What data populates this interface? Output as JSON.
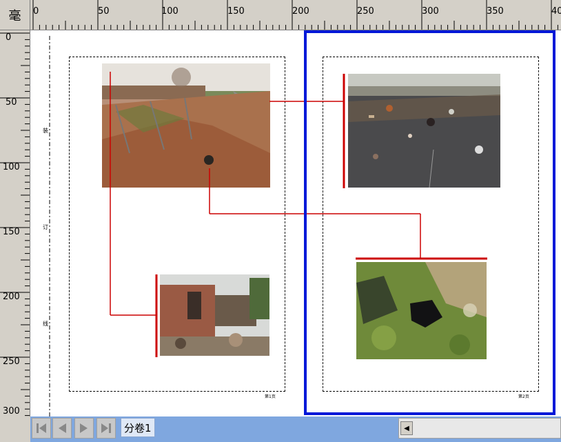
{
  "ruler": {
    "unit_label": "毫",
    "h_labels": [
      "0",
      "50",
      "100",
      "150",
      "200",
      "250",
      "300",
      "350",
      "40"
    ],
    "v_labels": [
      "0",
      "50",
      "100",
      "150",
      "200",
      "250",
      "300"
    ]
  },
  "binding_marks": [
    "装",
    "订",
    "线"
  ],
  "pages": [
    {
      "page_label": "第1页"
    },
    {
      "page_label": "第2页"
    }
  ],
  "bottom_bar": {
    "sheet_tab": "分卷1"
  },
  "colors": {
    "selection": "#0018d8",
    "connector": "#cc0000",
    "bottom_bar": "#7fa7df"
  },
  "icons": [
    "first-page-icon",
    "prev-page-icon",
    "next-page-icon",
    "last-page-icon",
    "scroll-left-arrow-icon"
  ]
}
